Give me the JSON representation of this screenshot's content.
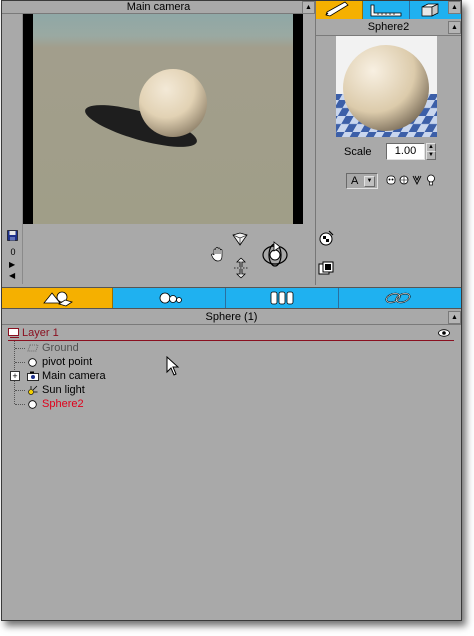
{
  "viewport": {
    "title": "Main camera"
  },
  "side_panel": {
    "object_name": "Sphere2",
    "scale_label": "Scale",
    "scale_value": "1.00",
    "material_letter": "A"
  },
  "left_strip": {
    "frame_value": "0"
  },
  "scene_panel": {
    "title": "Sphere (1)"
  },
  "scene_tree": {
    "layer": "Layer 1",
    "items": [
      {
        "label": "Ground"
      },
      {
        "label": "pivot point"
      },
      {
        "label": "Main camera"
      },
      {
        "label": "Sun light"
      },
      {
        "label": "Sphere2"
      }
    ]
  },
  "colors": {
    "accent_orange": "#f5b000",
    "accent_blue": "#1fb1f0",
    "selected_red": "#e0001a",
    "panel_gray": "#a9a9a9"
  }
}
